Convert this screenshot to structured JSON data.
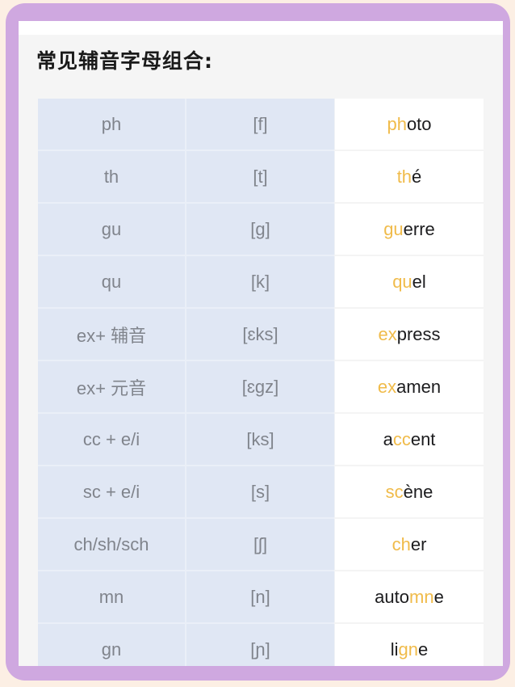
{
  "title": "常见辅音字母组合:",
  "colors": {
    "frame": "#cfa8e0",
    "background": "#fcefe4",
    "highlight": "#f0bb4a",
    "left_columns": "#e0e7f4",
    "example_text": "#1c1c1e"
  },
  "rows": [
    {
      "combo": "ph",
      "ipa": "[f]",
      "example": [
        {
          "t": "ph",
          "hl": true
        },
        {
          "t": "oto",
          "hl": false
        }
      ]
    },
    {
      "combo": "th",
      "ipa": "[t]",
      "example": [
        {
          "t": "th",
          "hl": true
        },
        {
          "t": "é",
          "hl": false
        }
      ]
    },
    {
      "combo": "gu",
      "ipa": "[g]",
      "example": [
        {
          "t": "gu",
          "hl": true
        },
        {
          "t": "erre",
          "hl": false
        }
      ]
    },
    {
      "combo": "qu",
      "ipa": "[k]",
      "example": [
        {
          "t": "qu",
          "hl": true
        },
        {
          "t": "el",
          "hl": false
        }
      ]
    },
    {
      "combo": "ex+ 辅音",
      "ipa": "[ɛks]",
      "example": [
        {
          "t": "ex",
          "hl": true
        },
        {
          "t": "press",
          "hl": false
        }
      ]
    },
    {
      "combo": "ex+ 元音",
      "ipa": "[ɛgz]",
      "example": [
        {
          "t": "ex",
          "hl": true
        },
        {
          "t": "amen",
          "hl": false
        }
      ]
    },
    {
      "combo": "cc + e/i",
      "ipa": "[ks]",
      "example": [
        {
          "t": "a",
          "hl": false
        },
        {
          "t": "cc",
          "hl": true
        },
        {
          "t": "ent",
          "hl": false
        }
      ]
    },
    {
      "combo": "sc + e/i",
      "ipa": "[s]",
      "example": [
        {
          "t": "sc",
          "hl": true
        },
        {
          "t": "ène",
          "hl": false
        }
      ]
    },
    {
      "combo": "ch/sh/sch",
      "ipa": "[ʃ]",
      "example": [
        {
          "t": "ch",
          "hl": true
        },
        {
          "t": "er",
          "hl": false
        }
      ]
    },
    {
      "combo": "mn",
      "ipa": "[n]",
      "example": [
        {
          "t": "auto",
          "hl": false
        },
        {
          "t": "mn",
          "hl": true
        },
        {
          "t": "e",
          "hl": false
        }
      ]
    },
    {
      "combo": "gn",
      "ipa": "[ɲ]",
      "example": [
        {
          "t": "li",
          "hl": false
        },
        {
          "t": "gn",
          "hl": true
        },
        {
          "t": "e",
          "hl": false
        }
      ]
    }
  ]
}
